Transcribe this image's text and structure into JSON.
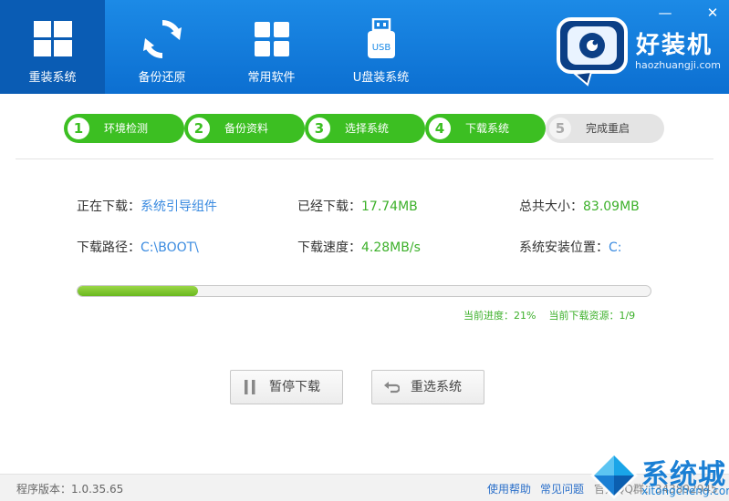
{
  "window": {
    "minimize_symbol": "—",
    "close_symbol": "✕"
  },
  "nav": [
    {
      "label": "重装系统",
      "icon": "windows-icon",
      "active": true
    },
    {
      "label": "备份还原",
      "icon": "sync-icon",
      "active": false
    },
    {
      "label": "常用软件",
      "icon": "apps-grid-icon",
      "active": false
    },
    {
      "label": "U盘装系统",
      "icon": "usb-icon",
      "active": false,
      "icon_text": "USB"
    }
  ],
  "brand": {
    "title": "好装机",
    "url": "haozhuangji.com"
  },
  "steps": [
    {
      "num": "1",
      "label": "环境检测",
      "state": "done"
    },
    {
      "num": "2",
      "label": "备份资料",
      "state": "done"
    },
    {
      "num": "3",
      "label": "选择系统",
      "state": "done"
    },
    {
      "num": "4",
      "label": "下载系统",
      "state": "done"
    },
    {
      "num": "5",
      "label": "完成重启",
      "state": "pending"
    }
  ],
  "info": {
    "downloading_label": "正在下载：",
    "downloading_value": "系统引导组件",
    "downloaded_label": "已经下载：",
    "downloaded_value": "17.74MB",
    "total_label": "总共大小：",
    "total_value": "83.09MB",
    "path_label": "下载路径：",
    "path_value": "C:\\BOOT\\",
    "speed_label": "下载速度：",
    "speed_value": "4.28MB/s",
    "install_label": "系统安装位置：",
    "install_value": "C:"
  },
  "progress": {
    "percent": 21,
    "progress_text": "当前进度：21%",
    "resource_text": "当前下载资源：1/9"
  },
  "buttons": {
    "pause": "暂停下载",
    "reselect": "重选系统"
  },
  "footer": {
    "version": "程序版本：1.0.35.65",
    "help": "使用帮助",
    "faq": "常见问题",
    "qq": "官方QQ群：343892945"
  },
  "watermark": {
    "title": "系统城",
    "url": "xitongcheng.com"
  },
  "colors": {
    "header": "#1c8ae6",
    "active_tab": "#0a5cb4",
    "step_green": "#3cbf22",
    "link_blue": "#3b8be0",
    "progress_green": "#6ab81e"
  }
}
